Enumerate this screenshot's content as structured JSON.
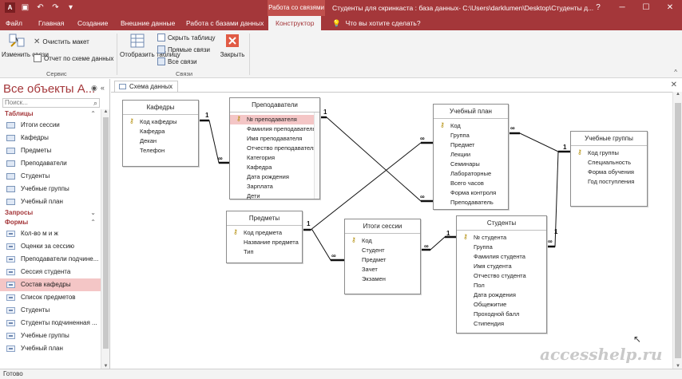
{
  "titlebar": {
    "contextual_tab": "Работа со связями",
    "title": "Студенты для скринкаста : база данных- C:\\Users\\darklumen\\Desktop\\Студенты д...",
    "minimize": "─",
    "maximize": "☐",
    "close": "✕",
    "colors": {
      "bar": "#a4373a",
      "context": "#c0504d"
    }
  },
  "tabs": {
    "file": "Файл",
    "home": "Главная",
    "create": "Создание",
    "external": "Внешние данные",
    "database": "Работа с базами данных",
    "design": "Конструктор",
    "tell_me": "Что вы хотите сделать?"
  },
  "ribbon": {
    "edit_relations": "Изменить связи",
    "clear_layout": "Очистить макет",
    "relation_report": "Отчет по схеме данных",
    "show_table": "Отобразить таблицу",
    "hide_table": "Скрыть таблицу",
    "direct_relations": "Прямые связи",
    "all_relations": "Все связи",
    "close": "Закрыть",
    "group_tools": "Сервис",
    "group_relations": "Связи"
  },
  "nav": {
    "title": "Все объекты A...",
    "search_placeholder": "Поиск...",
    "sections": {
      "tables": "Таблицы",
      "queries": "Запросы",
      "forms": "Формы"
    },
    "tables": [
      "Итоги сессии",
      "Кафедры",
      "Предметы",
      "Преподаватели",
      "Студенты",
      "Учебные группы",
      "Учебный план"
    ],
    "forms": [
      "Кол-во м и ж",
      "Оценки за сессию",
      "Преподаватели подчине...",
      "Сессия студента",
      "Состав кафедры",
      "Список предметов",
      "Студенты",
      "Студенты подчиненная ...",
      "Учебные группы",
      "Учебный план"
    ],
    "selected_form": "Состав кафедры"
  },
  "doc": {
    "tab_label": "Схема данных",
    "close": "✕"
  },
  "diagram": {
    "kafedry": {
      "title": "Кафедры",
      "fields": [
        "Код кафедры",
        "Кафедра",
        "Декан",
        "Телефон"
      ]
    },
    "prepod": {
      "title": "Преподаватели",
      "fields": [
        "№ преподавателя",
        "Фамилия преподавателя",
        "Имя преподавателя",
        "Отчество преподавателя",
        "Категория",
        "Кафедра",
        "Дата рождения",
        "Зарплата",
        "Дети"
      ]
    },
    "plan": {
      "title": "Учебный план",
      "fields": [
        "Код",
        "Группа",
        "Предмет",
        "Лекции",
        "Семинары",
        "Лабораторные",
        "Всего часов",
        "Форма контроля",
        "Преподаватель"
      ]
    },
    "groups": {
      "title": "Учебные группы",
      "fields": [
        "Код группы",
        "Специальность",
        "Форма обучения",
        "Год поступления"
      ]
    },
    "predmety": {
      "title": "Предметы",
      "fields": [
        "Код предмета",
        "Название предмета",
        "Тип"
      ]
    },
    "itogi": {
      "title": "Итоги сессии",
      "fields": [
        "Код",
        "Студент",
        "Предмет",
        "Зачет",
        "Экзамен"
      ]
    },
    "students": {
      "title": "Студенты",
      "fields": [
        "№ студента",
        "Группа",
        "Фамилия студента",
        "Имя студента",
        "Отчество студента",
        "Пол",
        "Дата рождения",
        "Общежитие",
        "Проходной балл",
        "Стипендия"
      ]
    },
    "one": "1",
    "many": "∞"
  },
  "status": {
    "text": "Готово"
  },
  "watermark": "accesshelp.ru"
}
